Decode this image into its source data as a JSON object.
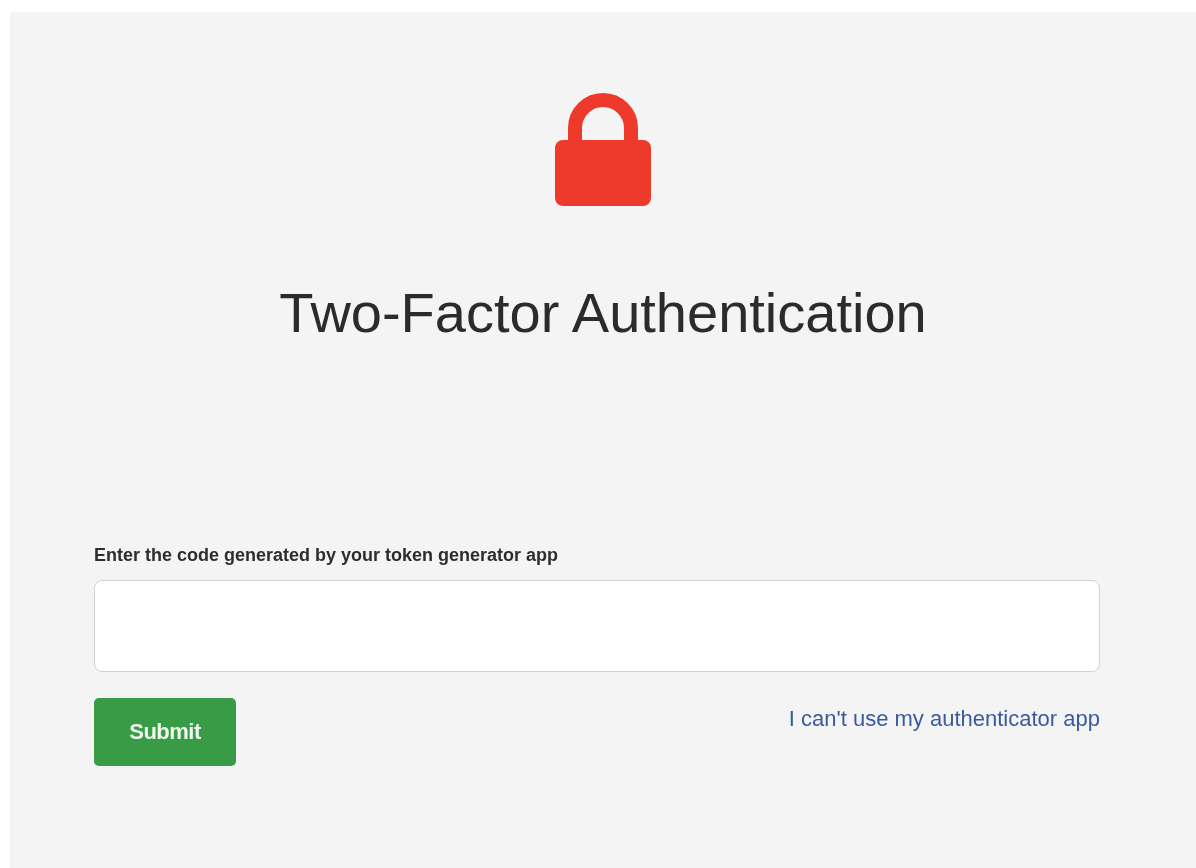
{
  "title": "Two-Factor Authentication",
  "form": {
    "label": "Enter the code generated by your token generator app",
    "submit": "Submit",
    "link": "I can't use my authenticator app"
  }
}
